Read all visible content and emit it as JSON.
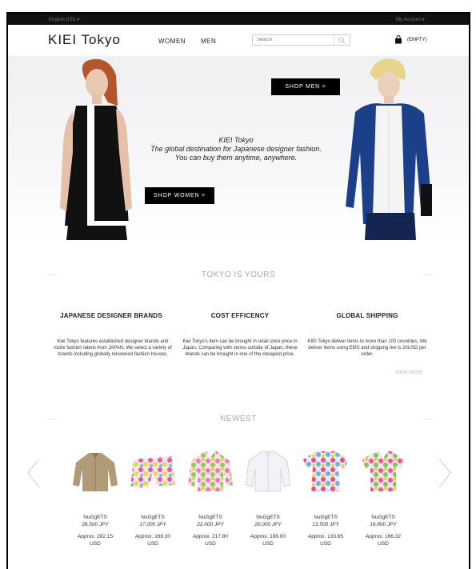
{
  "topbar": {
    "language": "English (US) ▾",
    "account": "My Account ▾"
  },
  "header": {
    "logo": "KIEI Tokyo",
    "nav": {
      "women": "WOMEN",
      "men": "MEN"
    },
    "search_placeholder": "Search",
    "cart_label": "(EMPTY)"
  },
  "hero": {
    "title": "KIEI Tokyo",
    "tagline": "The global destination for Japanese designer fashion.",
    "subline": "You can buy them anytime, anywhere.",
    "shop_men": "SHOP MEN >",
    "shop_women": "SHOP WOMEN >"
  },
  "features": {
    "section_title": "TOKYO IS YOURS",
    "items": [
      {
        "title": "JAPANESE DESIGNER BRANDS",
        "body": "Kiei Tokyo features established designer brands and niche fashion labels from JAPAN. We select a variety of brands including globally renowned fashion houses."
      },
      {
        "title": "COST EFFICENCY",
        "body": "Kiei Tokyo's item can be brought in retail store price in Japan. Comparing with stores outside of Japan, these brands can be brought in one of the cheapest price."
      },
      {
        "title": "GLOBAL SHIPPING",
        "body": "KIEI Tokyo deliver items to more than 100 countries. We deliver items using EMS and shipping fee is 20USD per order."
      }
    ],
    "view_more": "VIEW MORE"
  },
  "newest": {
    "section_title": "NEWEST",
    "products": [
      {
        "brand": "NuGgETS",
        "price": "28,500 JPY",
        "approx": "Approx. 282.15",
        "currency": "USD",
        "thumb": "khaki-shirt"
      },
      {
        "brand": "NuGgETS",
        "price": "17,000 JPY",
        "approx": "Approx. 168.30",
        "currency": "USD",
        "thumb": "print-shorts"
      },
      {
        "brand": "NuGgETS",
        "price": "22,000 JPY",
        "approx": "Approx. 217.80",
        "currency": "USD",
        "thumb": "print-shirt"
      },
      {
        "brand": "NuGgETS",
        "price": "20,000 JPY",
        "approx": "Approx. 198.00",
        "currency": "USD",
        "thumb": "white-shirt"
      },
      {
        "brand": "NuGgETS",
        "price": "13,500 JPY",
        "approx": "Approx. 133.65",
        "currency": "USD",
        "thumb": "print-tee"
      },
      {
        "brand": "NuGgETS",
        "price": "16,800 JPY",
        "approx": "Approx. 166.32",
        "currency": "USD",
        "thumb": "print-short-sleeve-shirt"
      }
    ]
  },
  "colors": {
    "topbar": "#111111",
    "button": "#000000",
    "muted_heading": "#aaaaaa"
  }
}
